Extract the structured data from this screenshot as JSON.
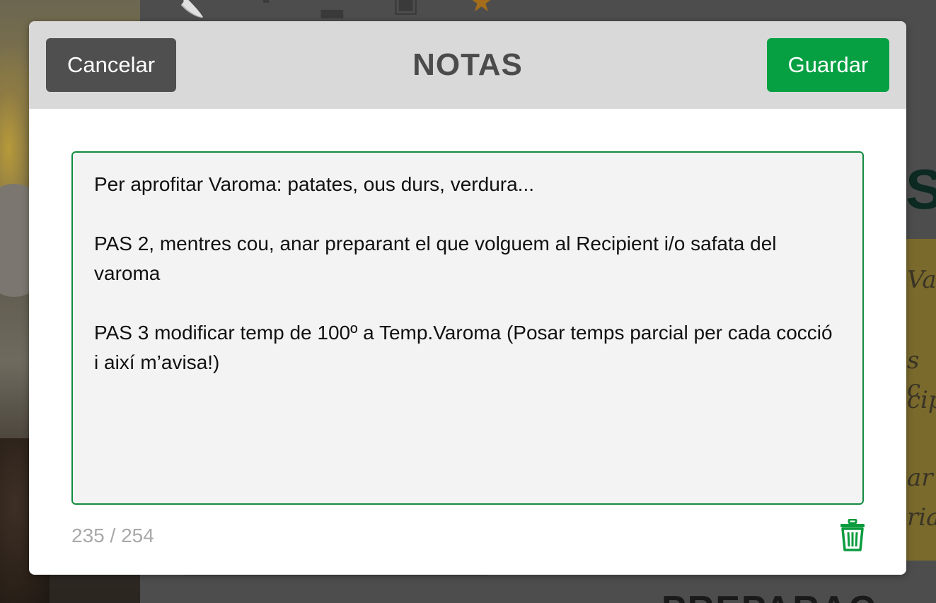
{
  "dialog": {
    "title": "NOTAS",
    "cancel_label": "Cancelar",
    "save_label": "Guardar",
    "notes_text": "Per aprofitar Varoma: patates, ous durs, verdura...\n\nPAS 2, mentres cou, anar preparant el que volguem al Recipient i/o safata del varoma\n\nPAS 3 modificar temp de 100º a Temp.Varoma (Posar temps parcial per cada cocció i així m’avisa!)",
    "char_count": "235",
    "char_separator": " / ",
    "char_limit": "254",
    "delete_icon": "trash-icon"
  },
  "background": {
    "letter": "S",
    "italic_lines": [
      "Va",
      "s c",
      "cip",
      "ar",
      "ria"
    ],
    "bottom_heading": "PREPARAC",
    "icons": [
      "knife-icon",
      "timer-icon",
      "servings-icon",
      "chef-hat-icon",
      "star-icon"
    ]
  },
  "colors": {
    "save_button": "#06a043",
    "cancel_button": "#4f4f4f",
    "header_bg": "#d9d9d9",
    "textarea_border": "#128a3e",
    "trash_icon": "#0a9b3f"
  }
}
